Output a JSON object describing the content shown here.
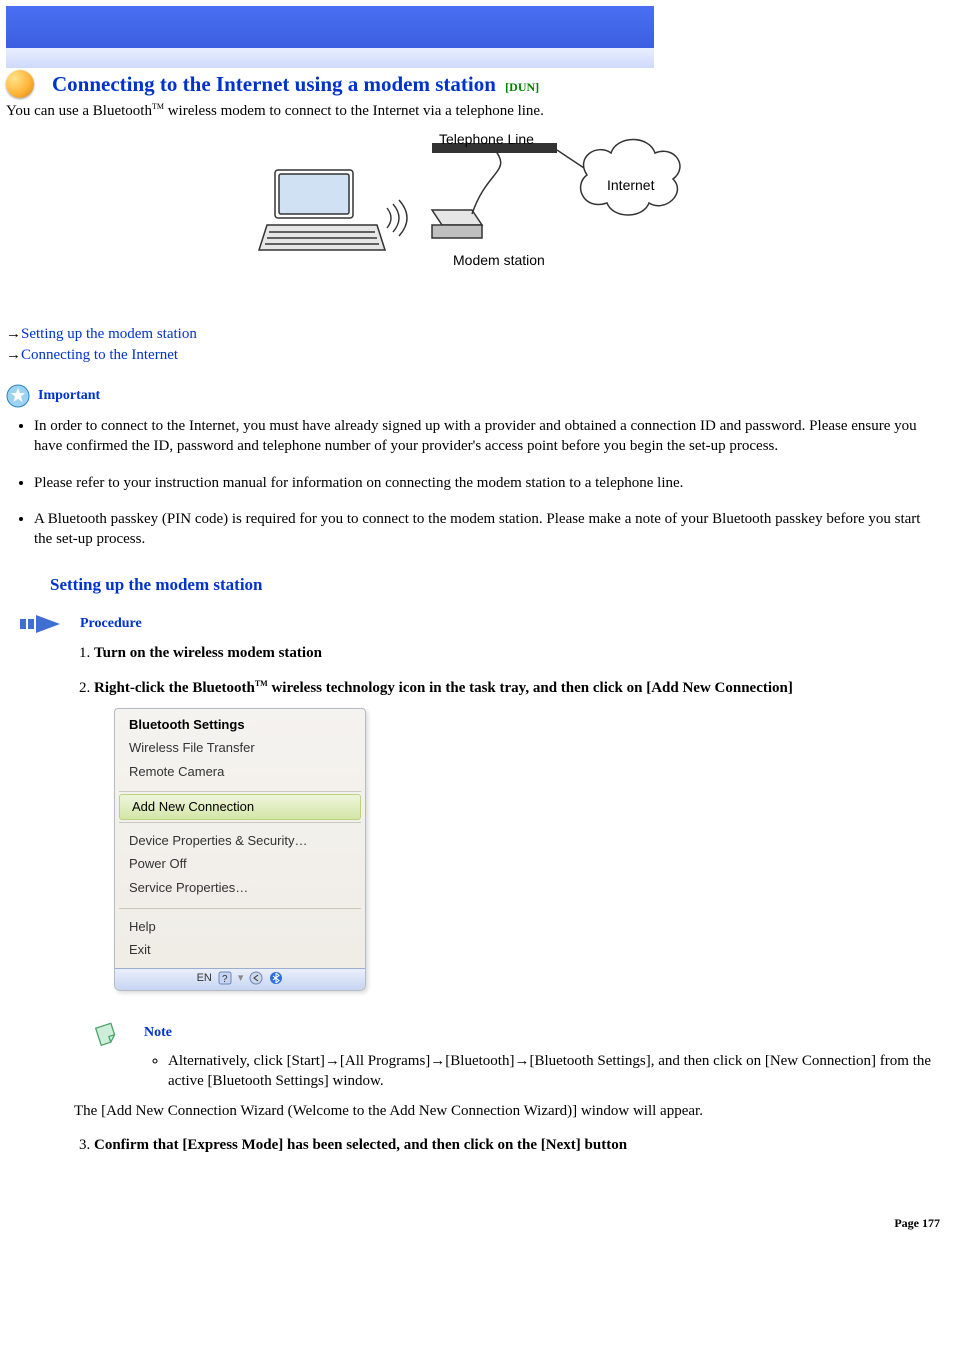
{
  "title": "Connecting to the Internet using a modem station",
  "title_tag": "[DUN]",
  "intro_pre": "You can use a Bluetooth",
  "intro_post": " wireless modem to connect to the Internet via a telephone line.",
  "diagram": {
    "telephone": "Telephone Line",
    "internet": "Internet",
    "modem": "Modem station"
  },
  "links": {
    "setup": "Setting up the modem station",
    "connect": "Connecting to the Internet"
  },
  "important_label": "Important",
  "important_bullets": [
    "In order to connect to the Internet, you must have already signed up with a provider and obtained a connection ID and password. Please ensure you have confirmed the ID, password and telephone number of your provider's access point before you begin the set-up process.",
    "Please refer to your instruction manual for information on connecting the modem station to a telephone line.",
    "A Bluetooth passkey (PIN code) is required for you to connect to the modem station. Please make a note of your Bluetooth passkey before you start the set-up process."
  ],
  "section_setup": "Setting up the modem station",
  "procedure_label": "Procedure",
  "steps": {
    "s1": "Turn on the wireless modem station",
    "s2_pre": "Right-click the Bluetooth",
    "s2_post": " wireless technology icon in the task tray, and then click on [Add New Connection]",
    "s3": "Confirm that [Express Mode] has been selected, and then click on the [Next] button"
  },
  "menu": {
    "title": "Bluetooth Settings",
    "wft": "Wireless File Transfer",
    "rc": "Remote Camera",
    "add": "Add New Connection",
    "dps": "Device Properties & Security…",
    "poff": "Power Off",
    "sp": "Service Properties…",
    "help": "Help",
    "exit": "Exit",
    "tray_lang": "EN"
  },
  "note_label": "Note",
  "note_item": "Alternatively, click [Start]→[All Programs]→[Bluetooth]→[Bluetooth Settings], and then click on [New Connection] from the active [Bluetooth Settings] window.",
  "wizard_line": "The [Add New Connection Wizard (Welcome to the Add New Connection Wizard)] window will appear.",
  "footer": "Page 177"
}
